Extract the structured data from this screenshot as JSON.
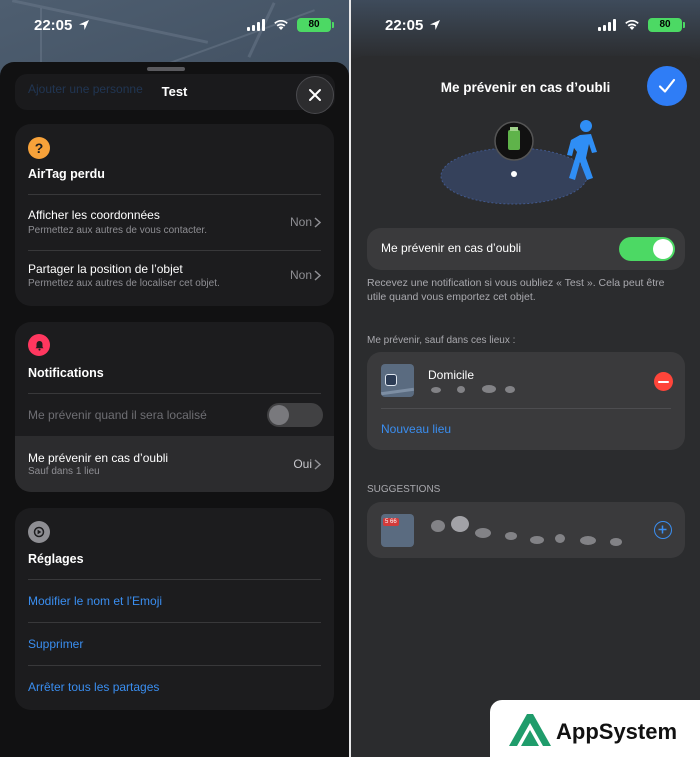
{
  "left": {
    "status": {
      "time": "22:05",
      "battery": "80"
    },
    "sheet": {
      "title": "Test",
      "behind_text": "Ajouter une personne"
    },
    "airtag_card": {
      "icon_glyph": "?",
      "title": "AirTag perdu",
      "rows": [
        {
          "title": "Afficher les coordonnées",
          "subtitle": "Permettez aux autres de vous contacter.",
          "value": "Non"
        },
        {
          "title": "Partager la position de l’objet",
          "subtitle": "Permettez aux autres de localiser cet objet.",
          "value": "Non"
        }
      ]
    },
    "notifications_card": {
      "title": "Notifications",
      "located_label": "Me prévenir quand il sera localisé",
      "forget": {
        "title": "Me prévenir en cas d’oubli",
        "subtitle": "Sauf dans 1 lieu",
        "value": "Oui"
      }
    },
    "settings_card": {
      "title": "Réglages",
      "links": [
        "Modifier le nom et l’Emoji",
        "Supprimer",
        "Arrêter tous les partages"
      ]
    }
  },
  "right": {
    "status": {
      "time": "22:05",
      "battery": "80"
    },
    "title": "Me prévenir en cas d’oubli",
    "toggle_label": "Me prévenir en cas d’oubli",
    "note": "Recevez une notification si vous oubliez « Test ». Cela peut être utile quand vous emportez cet objet.",
    "places_header": "Me prévenir, sauf dans ces lieux :",
    "place_name": "Domicile",
    "new_place": "Nouveau lieu",
    "suggestions_header": "SUGGESTIONS",
    "thumb_badge": "5 66"
  },
  "brand": {
    "name": "AppSystem"
  },
  "colors": {
    "accent": "#3a8ef0",
    "toggle_on": "#4cd964",
    "airtag_icon": "#f7a23a",
    "notif_icon": "#ff375f",
    "remove": "#ff453a",
    "brand_green": "#1f9c6b"
  }
}
